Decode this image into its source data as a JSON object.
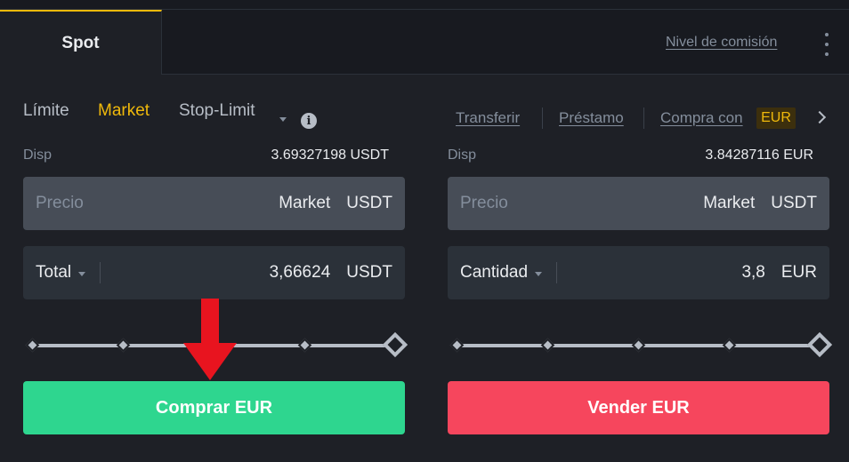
{
  "tabs": {
    "spot": "Spot",
    "fee_level": "Nivel de comisión"
  },
  "order_types": {
    "limit": "Límite",
    "market": "Market",
    "stop_limit": "Stop-Limit"
  },
  "links": {
    "transfer": "Transferir",
    "loan": "Préstamo",
    "buy_with": "Compra con",
    "buy_with_currency": "EUR"
  },
  "buy": {
    "avail_label": "Disp",
    "avail_value": "3.69327198 USDT",
    "price_placeholder": "Precio",
    "price_value": "Market",
    "price_unit": "USDT",
    "total_label": "Total",
    "total_value": "3,66624",
    "total_unit": "USDT",
    "button": "Comprar EUR"
  },
  "sell": {
    "avail_label": "Disp",
    "avail_value": "3.84287116 EUR",
    "price_placeholder": "Precio",
    "price_value": "Market",
    "price_unit": "USDT",
    "amount_label": "Cantidad",
    "amount_value": "3,8",
    "amount_unit": "EUR",
    "button": "Vender EUR"
  },
  "colors": {
    "accent": "#f0b90b",
    "buy": "#2ed68f",
    "sell": "#f6465d",
    "annotation": "#e8141f"
  },
  "icons": [
    "more-vertical-icon",
    "info-icon",
    "chevron-right-icon",
    "caret-down-icon",
    "arrow-down-annotation"
  ]
}
